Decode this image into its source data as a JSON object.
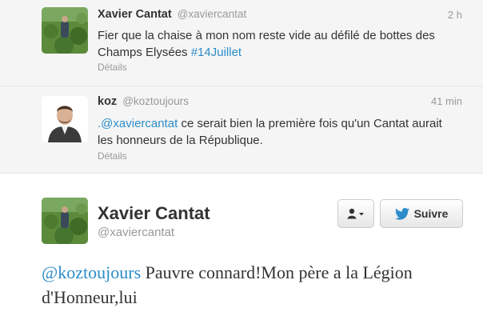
{
  "tweets": [
    {
      "name": "Xavier Cantat",
      "handle": "@xaviercantat",
      "time": "2 h",
      "text_before": "Fier que la chaise à mon nom reste vide au défilé de bottes des Champs Elysées ",
      "hashtag": "#14Juillet",
      "details": "Détails"
    },
    {
      "name": "koz",
      "handle": "@koztoujours",
      "time": "41 min",
      "mention": ".@xaviercantat",
      "text_after": " ce serait bien la première fois qu'un Cantat aurait les honneurs de la République.",
      "details": "Détails"
    }
  ],
  "main_tweet": {
    "name": "Xavier Cantat",
    "handle": "@xaviercantat",
    "follow_label": "Suivre",
    "mention": "@koztoujours",
    "text": " Pauvre connard!Mon père a la Légion d'Honneur,lui"
  },
  "colors": {
    "link": "#2b8cc9",
    "muted": "#999999",
    "text": "#333333",
    "feed_bg": "#f5f5f5"
  },
  "icons": {
    "user_menu": "person-dropdown-icon",
    "follow": "twitter-bird-icon"
  }
}
